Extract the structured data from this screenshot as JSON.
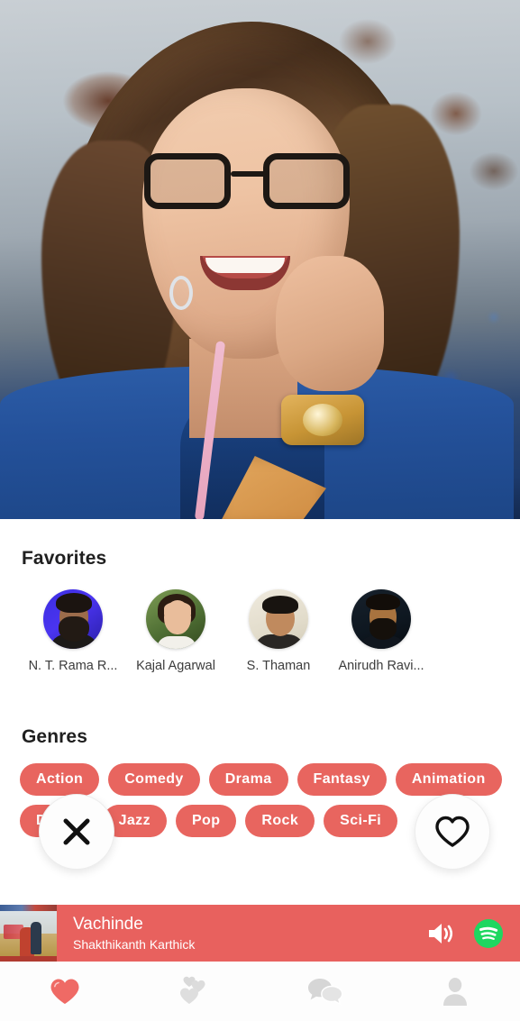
{
  "app": {
    "accent_color": "#e8655f",
    "player_bar_color": "#e8615e",
    "spotify_color": "#1ed760",
    "background_color": "#ffffff"
  },
  "hero": {
    "name": "hero-photo",
    "description": "Smiling young woman with eyeglasses resting chin on hand, wearing a blue denim jacket and gold wristwatch"
  },
  "favorites": {
    "title": "Favorites",
    "items": [
      {
        "name": "N. T. Rama R...",
        "avatar": "av1"
      },
      {
        "name": "Kajal Agarwal",
        "avatar": "av2"
      },
      {
        "name": "S. Thaman",
        "avatar": "av3"
      },
      {
        "name": "Anirudh Ravi...",
        "avatar": "av4"
      }
    ]
  },
  "genres": {
    "title": "Genres",
    "chips": [
      "Action",
      "Comedy",
      "Drama",
      "Fantasy",
      "Animation",
      "Disco",
      "Jazz",
      "Pop",
      "Rock",
      "Sci-Fi"
    ]
  },
  "fabs": {
    "dismiss": {
      "icon": "close-x-icon",
      "label": "Dismiss"
    },
    "like": {
      "icon": "heart-outline-icon",
      "label": "Like"
    }
  },
  "player": {
    "track_title": "Vachinde",
    "track_artist": "Shakthikanth Karthick",
    "album_art": "movie-poster-thumbnail",
    "volume_icon": "volume-up-icon",
    "service_icon": "spotify-icon"
  },
  "bottom_nav": {
    "items": [
      {
        "icon": "heart-filled-icon",
        "label": "Favorites",
        "active": true
      },
      {
        "icon": "multiple-hearts-icon",
        "label": "Matches",
        "active": false
      },
      {
        "icon": "chat-bubbles-icon",
        "label": "Messages",
        "active": false
      },
      {
        "icon": "person-icon",
        "label": "Profile",
        "active": false
      }
    ]
  }
}
